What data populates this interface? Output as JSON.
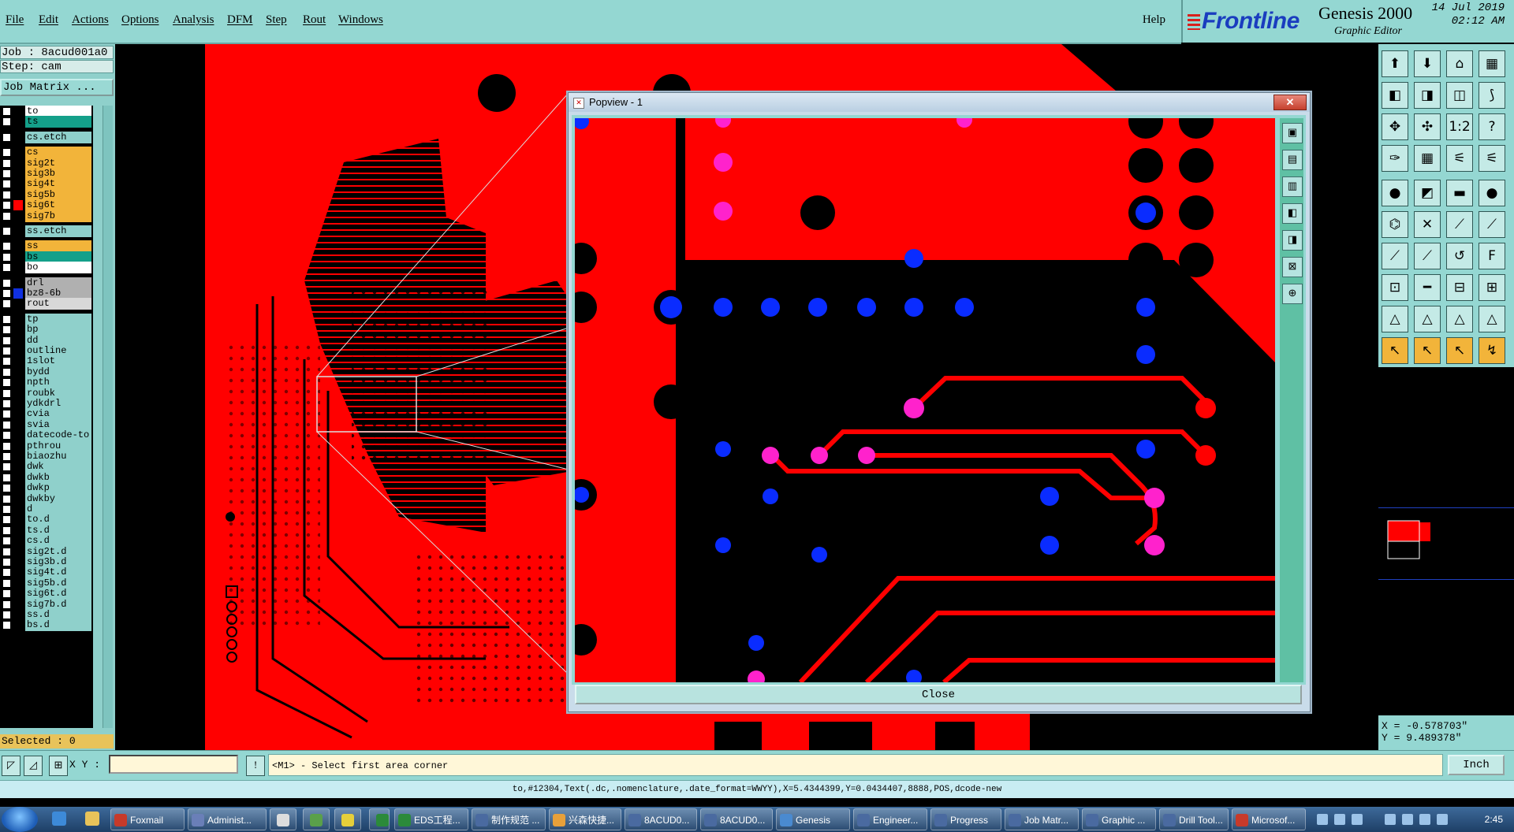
{
  "menu": {
    "items": [
      "File",
      "Edit",
      "Actions",
      "Options",
      "Analysis",
      "DFM",
      "Step",
      "Rout",
      "Windows"
    ],
    "help": "Help"
  },
  "brand": {
    "logo": "Frontline",
    "product": "Genesis 2000",
    "subtitle": "Graphic Editor",
    "date": "14 Jul 2019",
    "time": "02:12 AM"
  },
  "left_panel": {
    "job": "Job : 8acud001a0",
    "step": "Step: cam",
    "job_matrix": "Job Matrix ...",
    "selected": "Selected : 0",
    "layers": [
      {
        "name": "to",
        "color": "#ffffff",
        "group": 0
      },
      {
        "name": "ts",
        "color": "#14a08a",
        "group": 0
      },
      {
        "name": "cs.etch",
        "color": "#8fd0cb",
        "group": 1
      },
      {
        "name": "cs",
        "color": "#f2b43a",
        "group": 2
      },
      {
        "name": "sig2t",
        "color": "#f2b43a",
        "group": 2
      },
      {
        "name": "sig3b",
        "color": "#f2b43a",
        "group": 2
      },
      {
        "name": "sig4t",
        "color": "#f2b43a",
        "group": 2
      },
      {
        "name": "sig5b",
        "color": "#f2b43a",
        "group": 2
      },
      {
        "name": "sig6t",
        "color": "#f2b43a",
        "group": 2,
        "active": true
      },
      {
        "name": "sig7b",
        "color": "#f2b43a",
        "group": 2
      },
      {
        "name": "ss.etch",
        "color": "#8fd0cb",
        "group": 3
      },
      {
        "name": "ss",
        "color": "#f2b43a",
        "group": 4
      },
      {
        "name": "bs",
        "color": "#14a08a",
        "group": 4
      },
      {
        "name": "bo",
        "color": "#ffffff",
        "group": 4
      },
      {
        "name": "drl",
        "color": "#b0b0b0",
        "group": 5
      },
      {
        "name": "bz8-6b",
        "color": "#b0b0b0",
        "group": 5,
        "swatch": "#1030e0"
      },
      {
        "name": "rout",
        "color": "#d8d8d8",
        "group": 5
      },
      {
        "name": "tp",
        "color": "#8fd0cb",
        "group": 6
      },
      {
        "name": "bp",
        "color": "#8fd0cb",
        "group": 6
      },
      {
        "name": "dd",
        "color": "#8fd0cb",
        "group": 6
      },
      {
        "name": "outline",
        "color": "#8fd0cb",
        "group": 6
      },
      {
        "name": "1slot",
        "color": "#8fd0cb",
        "group": 6
      },
      {
        "name": "bydd",
        "color": "#8fd0cb",
        "group": 6
      },
      {
        "name": "npth",
        "color": "#8fd0cb",
        "group": 6
      },
      {
        "name": "roubk",
        "color": "#8fd0cb",
        "group": 6
      },
      {
        "name": "ydkdrl",
        "color": "#8fd0cb",
        "group": 6
      },
      {
        "name": "cvia",
        "color": "#8fd0cb",
        "group": 6
      },
      {
        "name": "svia",
        "color": "#8fd0cb",
        "group": 6
      },
      {
        "name": "datecode-to",
        "color": "#8fd0cb",
        "group": 6
      },
      {
        "name": "pthrou",
        "color": "#8fd0cb",
        "group": 6
      },
      {
        "name": "biaozhu",
        "color": "#8fd0cb",
        "group": 6
      },
      {
        "name": "dwk",
        "color": "#8fd0cb",
        "group": 6
      },
      {
        "name": "dwkb",
        "color": "#8fd0cb",
        "group": 6
      },
      {
        "name": "dwkp",
        "color": "#8fd0cb",
        "group": 6
      },
      {
        "name": "dwkby",
        "color": "#8fd0cb",
        "group": 6
      },
      {
        "name": "d",
        "color": "#8fd0cb",
        "group": 6
      },
      {
        "name": "to.d",
        "color": "#8fd0cb",
        "group": 6
      },
      {
        "name": "ts.d",
        "color": "#8fd0cb",
        "group": 6
      },
      {
        "name": "cs.d",
        "color": "#8fd0cb",
        "group": 6
      },
      {
        "name": "sig2t.d",
        "color": "#8fd0cb",
        "group": 6
      },
      {
        "name": "sig3b.d",
        "color": "#8fd0cb",
        "group": 6
      },
      {
        "name": "sig4t.d",
        "color": "#8fd0cb",
        "group": 6
      },
      {
        "name": "sig5b.d",
        "color": "#8fd0cb",
        "group": 6
      },
      {
        "name": "sig6t.d",
        "color": "#8fd0cb",
        "group": 6
      },
      {
        "name": "sig7b.d",
        "color": "#8fd0cb",
        "group": 6
      },
      {
        "name": "ss.d",
        "color": "#8fd0cb",
        "group": 6
      },
      {
        "name": "bs.d",
        "color": "#8fd0cb",
        "group": 6
      }
    ]
  },
  "popview": {
    "title": "Popview - 1",
    "close_label": "Close"
  },
  "coords": {
    "x": "X = -0.578703\"",
    "y": "Y = 9.489378\""
  },
  "command": {
    "xy_label": "X Y :",
    "prompt": "<M1> - Select first area corner",
    "units": "Inch"
  },
  "info_line": "to,#12304,Text(.dc,.nomenclature,.date_format=WWYY),X=5.4344399,Y=0.0434407,8888,POS,dcode-new",
  "taskbar": {
    "items": [
      "Foxmail",
      "Administ...",
      "",
      "",
      "",
      "",
      "EDS工程...",
      "制作规范 ...",
      "兴森快捷...",
      "8ACUD0...",
      "8ACUD0...",
      "Genesis",
      "Engineer...",
      "Progress",
      "Job Matr...",
      "Graphic ...",
      "Drill Tool...",
      "Microsof..."
    ],
    "clock": "2:45"
  },
  "colors": {
    "board_red": "#ff0000",
    "pad_blue": "#0a2cff",
    "pad_magenta": "#ff22cc",
    "panel_teal": "#94d7d2"
  }
}
